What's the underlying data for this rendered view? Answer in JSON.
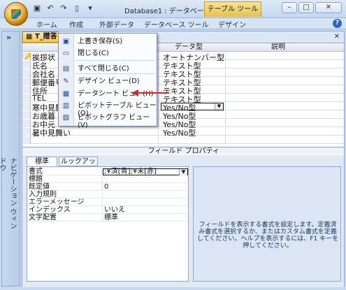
{
  "titlebar": {
    "window_title": "Database1 : データベース ...",
    "tool_tab": "テーブル ツール",
    "qat_icons": [
      "save-icon",
      "undo-icon",
      "redo-icon",
      "new-icon",
      "customize-icon"
    ]
  },
  "ribbon": {
    "tabs": [
      "ホーム",
      "作成",
      "外部データ",
      "データベース ツール",
      "デザイン"
    ]
  },
  "nav_pane": {
    "label": "ナビゲーション ウィンドウ"
  },
  "doc_tab": {
    "label": "T_贈答"
  },
  "grid": {
    "col_type": "データ型",
    "col_desc": "説明",
    "rows": [
      {
        "name": "挨拶状",
        "type": "オートナンバー型"
      },
      {
        "name": "氏名",
        "type": "テキスト型"
      },
      {
        "name": "会社名",
        "type": "テキスト型"
      },
      {
        "name": "郵便番号",
        "type": "テキスト型"
      },
      {
        "name": "住所",
        "type": "テキスト型"
      },
      {
        "name": "TEL",
        "type": "テキスト型"
      },
      {
        "name": "寒中見舞い",
        "type": "Yes/No型"
      },
      {
        "name": "お歳暮",
        "type": "Yes/No型"
      },
      {
        "name": "お中元",
        "type": "Yes/No型"
      },
      {
        "name": "暑中見舞い",
        "type": "Yes/No型"
      },
      {
        "name": "",
        "type": ""
      }
    ]
  },
  "field_props": {
    "section_label": "フィールド プロパティ",
    "tabs": [
      "標準",
      "ルックアップ"
    ],
    "rows": [
      {
        "label": "書式",
        "value": ";¥済[青];¥未[赤]"
      },
      {
        "label": "標題",
        "value": ""
      },
      {
        "label": "既定値",
        "value": "0"
      },
      {
        "label": "入力規則",
        "value": ""
      },
      {
        "label": "エラーメッセージ",
        "value": ""
      },
      {
        "label": "インデックス",
        "value": "いいえ"
      },
      {
        "label": "文字配置",
        "value": "標準"
      }
    ],
    "help": "フィールドを表示する書式を設定します。定義済み書式を選択するか、またはカスタム書式を定義してください。ヘルプを表示するには、F1 キーを押してください。"
  },
  "context_menu": {
    "items": [
      {
        "label": "上書き保存(S)",
        "icon": "save-icon"
      },
      {
        "label": "閉じる(C)",
        "icon": "close-doc-icon"
      },
      {
        "label": "すべて閉じる(C)",
        "icon": "close-all-icon"
      },
      {
        "label": "デザイン ビュー(D)",
        "icon": "design-view-icon"
      },
      {
        "label": "データシート ビュー(H)",
        "icon": "datasheet-view-icon"
      },
      {
        "label": "ピボットテーブル ビュー(O)",
        "icon": "pivot-table-icon"
      },
      {
        "label": "ピボットグラフ ビュー(V)",
        "icon": "pivot-chart-icon"
      }
    ]
  },
  "colors": {
    "arrow": "#e0202a",
    "accent_tab": "#f5c64a"
  }
}
